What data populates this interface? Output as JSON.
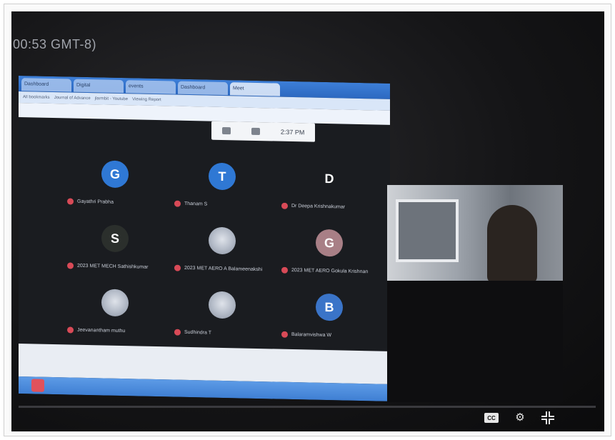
{
  "video": {
    "timestamp_label": "00:53 GMT-8)"
  },
  "browser": {
    "tabs": [
      "Dashboard",
      "Digital",
      "events",
      "Dashboard",
      "Meet"
    ],
    "bookmarks": [
      "All bookmarks",
      "Journal of Advance",
      "jlarmbit - Youtube",
      "Viewing Report"
    ]
  },
  "meeting": {
    "time": "2:37 PM",
    "participants": [
      {
        "initial": "G",
        "name": "Gayathri Prabha",
        "color": "#2f78d4",
        "photo": false
      },
      {
        "initial": "T",
        "name": "Thanam S",
        "color": "#2f78d4",
        "photo": false
      },
      {
        "initial": "D",
        "name": "Dr Deepa Krishnakumar",
        "color": "transparent",
        "photo": false
      },
      {
        "initial": "S",
        "name": "2023 MET MECH Sathishkumar",
        "color": "#2b2f2c",
        "photo": false
      },
      {
        "initial": "",
        "name": "2023 MET AERO A Balameenakshi",
        "color": "#8f97a6",
        "photo": true
      },
      {
        "initial": "G",
        "name": "2023 MET AERO Gokula Krishnan",
        "color": "#a87f86",
        "photo": false
      },
      {
        "initial": "",
        "name": "Jeevanantham muthu",
        "color": "#c7ccd4",
        "photo": true
      },
      {
        "initial": "",
        "name": "Sudhindra T",
        "color": "#cfd4dc",
        "photo": true
      },
      {
        "initial": "B",
        "name": "Balaramvishwa W",
        "color": "#3a74c8",
        "photo": false
      }
    ]
  },
  "controls": {
    "cc_label": "CC",
    "settings_icon": "gear-icon",
    "exit_fullscreen_icon": "exit-fullscreen-icon"
  }
}
